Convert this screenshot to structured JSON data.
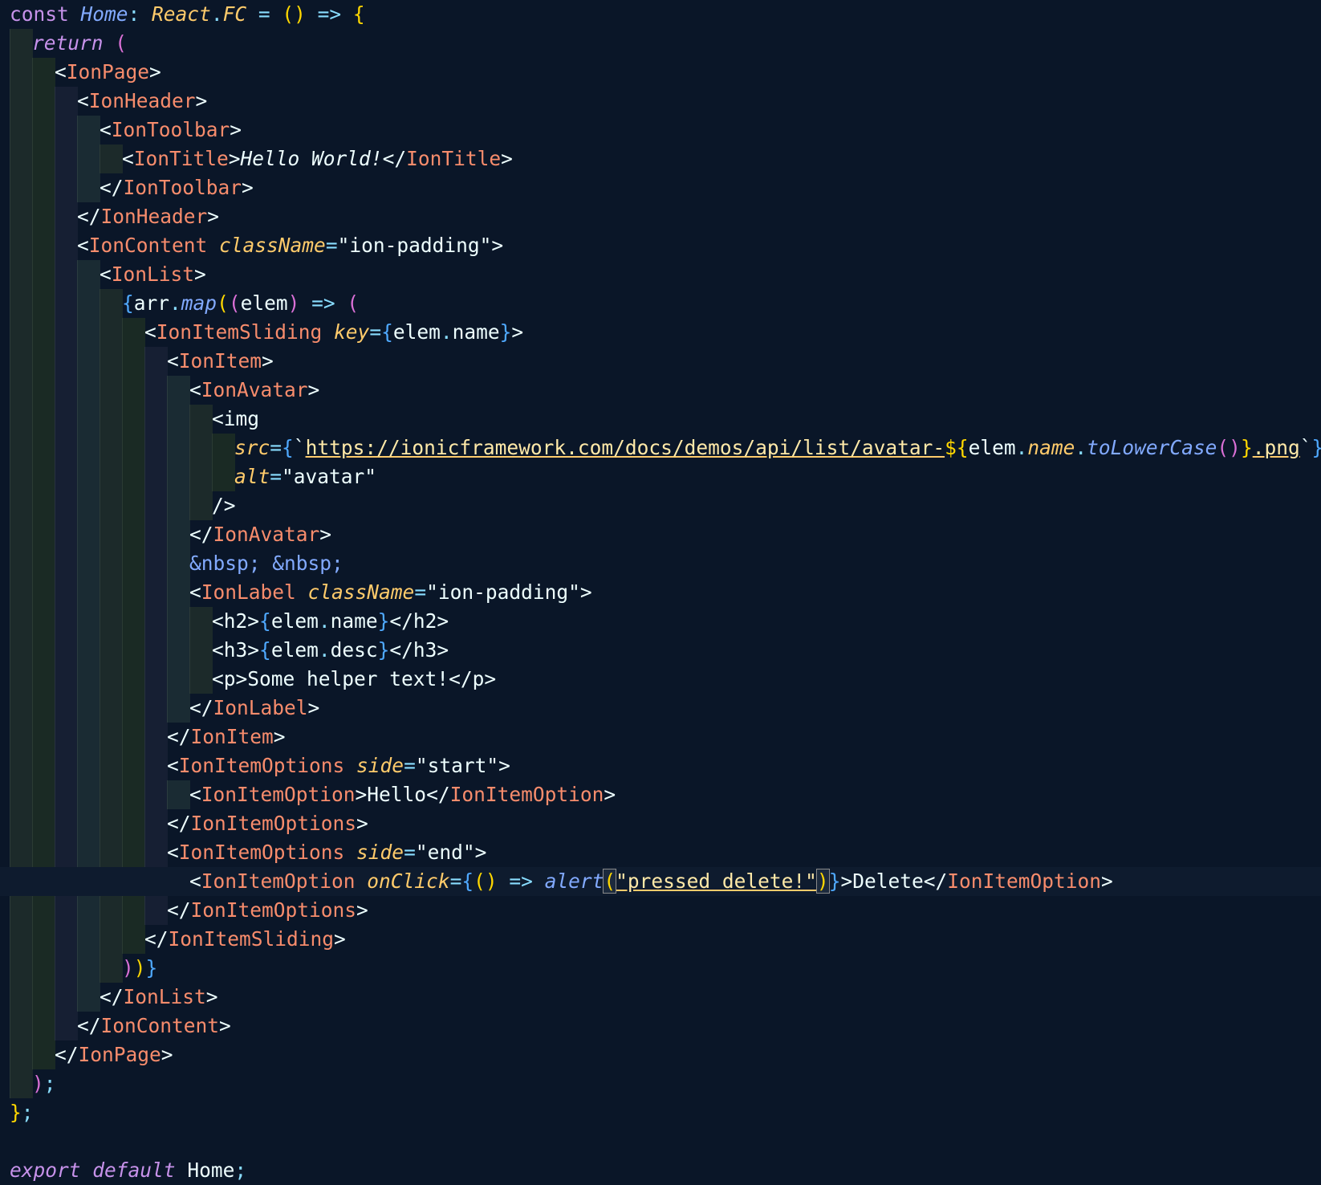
{
  "editor": {
    "theme": {
      "background": "#0a1628",
      "current_line": "#0e1b2e",
      "guide_colors": [
        "#1c2a2a",
        "#1a2a24",
        "#161f33",
        "#1a2b33"
      ]
    },
    "lines": [
      [
        [
          "const ",
          "kw"
        ],
        [
          "Home",
          "fn"
        ],
        [
          ": ",
          "op"
        ],
        [
          "React",
          "type"
        ],
        [
          ".",
          "op"
        ],
        [
          "FC",
          "type"
        ],
        [
          " = ",
          "op"
        ],
        [
          "()",
          "brace1"
        ],
        [
          " => ",
          "op"
        ],
        [
          "{",
          "brace1"
        ]
      ],
      [
        [
          "return",
          "kwi"
        ],
        [
          " ",
          "text"
        ],
        [
          "(",
          "brace2"
        ]
      ],
      [
        [
          "<",
          "tagb"
        ],
        [
          "IonPage",
          "tagc"
        ],
        [
          ">",
          "tagb"
        ]
      ],
      [
        [
          "<",
          "tagb"
        ],
        [
          "IonHeader",
          "tagc"
        ],
        [
          ">",
          "tagb"
        ]
      ],
      [
        [
          "<",
          "tagb"
        ],
        [
          "IonToolbar",
          "tagc"
        ],
        [
          ">",
          "tagb"
        ]
      ],
      [
        [
          "<",
          "tagb"
        ],
        [
          "IonTitle",
          "tagc"
        ],
        [
          ">",
          "tagb"
        ],
        [
          "Hello World!",
          "it"
        ],
        [
          "</",
          "tagb"
        ],
        [
          "IonTitle",
          "tagc"
        ],
        [
          ">",
          "tagb"
        ]
      ],
      [
        [
          "</",
          "tagb"
        ],
        [
          "IonToolbar",
          "tagc"
        ],
        [
          ">",
          "tagb"
        ]
      ],
      [
        [
          "</",
          "tagb"
        ],
        [
          "IonHeader",
          "tagc"
        ],
        [
          ">",
          "tagb"
        ]
      ],
      [
        [
          "<",
          "tagb"
        ],
        [
          "IonContent",
          "tagc"
        ],
        [
          " ",
          "text"
        ],
        [
          "className",
          "attr"
        ],
        [
          "=",
          "op"
        ],
        [
          "\"ion-padding\"",
          "str"
        ],
        [
          ">",
          "tagb"
        ]
      ],
      [
        [
          "<",
          "tagb"
        ],
        [
          "IonList",
          "tagc"
        ],
        [
          ">",
          "tagb"
        ]
      ],
      [
        [
          "{",
          "brace3"
        ],
        [
          "arr",
          "var"
        ],
        [
          ".",
          "op"
        ],
        [
          "map",
          "fn"
        ],
        [
          "(",
          "brace1"
        ],
        [
          "(",
          "brace2"
        ],
        [
          "elem",
          "var"
        ],
        [
          ")",
          "brace2"
        ],
        [
          " => ",
          "op"
        ],
        [
          "(",
          "brace2"
        ]
      ],
      [
        [
          "<",
          "tagb"
        ],
        [
          "IonItemSliding",
          "tagc"
        ],
        [
          " ",
          "text"
        ],
        [
          "key",
          "attr"
        ],
        [
          "=",
          "op"
        ],
        [
          "{",
          "brace3"
        ],
        [
          "elem",
          "var"
        ],
        [
          ".",
          "op"
        ],
        [
          "name",
          "var"
        ],
        [
          "}",
          "brace3"
        ],
        [
          ">",
          "tagb"
        ]
      ],
      [
        [
          "<",
          "tagb"
        ],
        [
          "IonItem",
          "tagc"
        ],
        [
          ">",
          "tagb"
        ]
      ],
      [
        [
          "<",
          "tagb"
        ],
        [
          "IonAvatar",
          "tagc"
        ],
        [
          ">",
          "tagb"
        ]
      ],
      [
        [
          "<",
          "tagb"
        ],
        [
          "img",
          "tagb"
        ]
      ],
      [
        [
          "src",
          "attr"
        ],
        [
          "=",
          "op"
        ],
        [
          "{",
          "brace3"
        ],
        [
          "`",
          "text"
        ],
        [
          "https://ionicframework.com/docs/demos/api/list/avatar-",
          "url"
        ],
        [
          "${",
          "brace1"
        ],
        [
          "elem",
          "var"
        ],
        [
          ".",
          "op"
        ],
        [
          "name",
          "propi"
        ],
        [
          ".",
          "op"
        ],
        [
          "toLowerCase",
          "fn"
        ],
        [
          "()",
          "brace2"
        ],
        [
          "}",
          "brace1"
        ],
        [
          ".png",
          "url"
        ],
        [
          "`",
          "text"
        ],
        [
          "}",
          "brace3"
        ]
      ],
      [
        [
          "alt",
          "attr"
        ],
        [
          "=",
          "op"
        ],
        [
          "\"avatar\"",
          "str"
        ]
      ],
      [
        [
          "/>",
          "tagb"
        ]
      ],
      [
        [
          "</",
          "tagb"
        ],
        [
          "IonAvatar",
          "tagc"
        ],
        [
          ">",
          "tagb"
        ]
      ],
      [
        [
          "&nbsp; &nbsp;",
          "ent"
        ]
      ],
      [
        [
          "<",
          "tagb"
        ],
        [
          "IonLabel",
          "tagc"
        ],
        [
          " ",
          "text"
        ],
        [
          "className",
          "attr"
        ],
        [
          "=",
          "op"
        ],
        [
          "\"ion-padding\"",
          "str"
        ],
        [
          ">",
          "tagb"
        ]
      ],
      [
        [
          "<",
          "tagb"
        ],
        [
          "h2",
          "tagb"
        ],
        [
          ">",
          "tagb"
        ],
        [
          "{",
          "brace3"
        ],
        [
          "elem",
          "var"
        ],
        [
          ".",
          "op"
        ],
        [
          "name",
          "var"
        ],
        [
          "}",
          "brace3"
        ],
        [
          "</",
          "tagb"
        ],
        [
          "h2",
          "tagb"
        ],
        [
          ">",
          "tagb"
        ]
      ],
      [
        [
          "<",
          "tagb"
        ],
        [
          "h3",
          "tagb"
        ],
        [
          ">",
          "tagb"
        ],
        [
          "{",
          "brace3"
        ],
        [
          "elem",
          "var"
        ],
        [
          ".",
          "op"
        ],
        [
          "desc",
          "var"
        ],
        [
          "}",
          "brace3"
        ],
        [
          "</",
          "tagb"
        ],
        [
          "h3",
          "tagb"
        ],
        [
          ">",
          "tagb"
        ]
      ],
      [
        [
          "<",
          "tagb"
        ],
        [
          "p",
          "tagb"
        ],
        [
          ">",
          "tagb"
        ],
        [
          "Some helper text!",
          "text"
        ],
        [
          "</",
          "tagb"
        ],
        [
          "p",
          "tagb"
        ],
        [
          ">",
          "tagb"
        ]
      ],
      [
        [
          "</",
          "tagb"
        ],
        [
          "IonLabel",
          "tagc"
        ],
        [
          ">",
          "tagb"
        ]
      ],
      [
        [
          "</",
          "tagb"
        ],
        [
          "IonItem",
          "tagc"
        ],
        [
          ">",
          "tagb"
        ]
      ],
      [
        [
          "<",
          "tagb"
        ],
        [
          "IonItemOptions",
          "tagc"
        ],
        [
          " ",
          "text"
        ],
        [
          "side",
          "attr"
        ],
        [
          "=",
          "op"
        ],
        [
          "\"start\"",
          "str"
        ],
        [
          ">",
          "tagb"
        ]
      ],
      [
        [
          "<",
          "tagb"
        ],
        [
          "IonItemOption",
          "tagc"
        ],
        [
          ">",
          "tagb"
        ],
        [
          "Hello",
          "text"
        ],
        [
          "</",
          "tagb"
        ],
        [
          "IonItemOption",
          "tagc"
        ],
        [
          ">",
          "tagb"
        ]
      ],
      [
        [
          "</",
          "tagb"
        ],
        [
          "IonItemOptions",
          "tagc"
        ],
        [
          ">",
          "tagb"
        ]
      ],
      [
        [
          "<",
          "tagb"
        ],
        [
          "IonItemOptions",
          "tagc"
        ],
        [
          " ",
          "text"
        ],
        [
          "side",
          "attr"
        ],
        [
          "=",
          "op"
        ],
        [
          "\"end\"",
          "str"
        ],
        [
          ">",
          "tagb"
        ]
      ],
      [
        [
          "<",
          "tagb"
        ],
        [
          "IonItemOption",
          "tagc"
        ],
        [
          " ",
          "text"
        ],
        [
          "onClick",
          "attr"
        ],
        [
          "=",
          "op"
        ],
        [
          "{",
          "brace3"
        ],
        [
          "()",
          "brace1"
        ],
        [
          " => ",
          "op"
        ],
        [
          "alert",
          "fn"
        ],
        [
          "(",
          "bm"
        ],
        [
          "\"pressed delete!\"",
          "strul"
        ],
        [
          ")",
          "bm"
        ],
        [
          "}",
          "brace3"
        ],
        [
          ">",
          "tagb"
        ],
        [
          "Delete",
          "text"
        ],
        [
          "</",
          "tagb"
        ],
        [
          "IonItemOption",
          "tagc"
        ],
        [
          ">",
          "tagb"
        ]
      ],
      [
        [
          "</",
          "tagb"
        ],
        [
          "IonItemOptions",
          "tagc"
        ],
        [
          ">",
          "tagb"
        ]
      ],
      [
        [
          "</",
          "tagb"
        ],
        [
          "IonItemSliding",
          "tagc"
        ],
        [
          ">",
          "tagb"
        ]
      ],
      [
        [
          ")",
          "brace2"
        ],
        [
          ")",
          "brace1"
        ],
        [
          "}",
          "brace3"
        ]
      ],
      [
        [
          "</",
          "tagb"
        ],
        [
          "IonList",
          "tagc"
        ],
        [
          ">",
          "tagb"
        ]
      ],
      [
        [
          "</",
          "tagb"
        ],
        [
          "IonContent",
          "tagc"
        ],
        [
          ">",
          "tagb"
        ]
      ],
      [
        [
          "</",
          "tagb"
        ],
        [
          "IonPage",
          "tagc"
        ],
        [
          ">",
          "tagb"
        ]
      ],
      [
        [
          ")",
          "brace2"
        ],
        [
          ";",
          "op"
        ]
      ],
      [
        [
          "}",
          "brace1"
        ],
        [
          ";",
          "op"
        ]
      ],
      [],
      [
        [
          "export",
          "kwi"
        ],
        [
          " ",
          "text"
        ],
        [
          "default",
          "kwi"
        ],
        [
          " ",
          "text"
        ],
        [
          "Home",
          "text"
        ],
        [
          ";",
          "op"
        ]
      ]
    ],
    "current_line_index": 30
  }
}
